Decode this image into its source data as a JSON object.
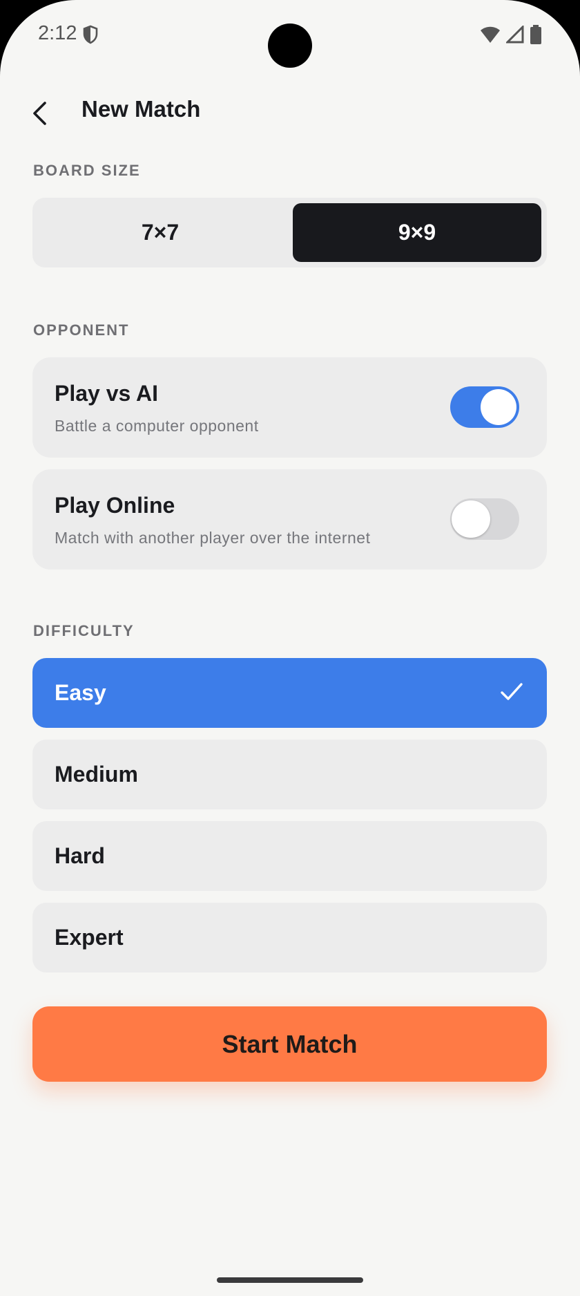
{
  "status_bar": {
    "time": "2:12",
    "icons": [
      "shield-icon",
      "wifi-icon",
      "cellular-icon",
      "battery-icon"
    ]
  },
  "app_bar": {
    "back_icon": "back-arrow-icon",
    "title": "New Match"
  },
  "board_size": {
    "label": "BOARD SIZE",
    "options": [
      "7×7",
      "9×9"
    ],
    "selected": "9×9"
  },
  "opponent": {
    "label": "OPPONENT",
    "options": [
      {
        "title": "Play vs AI",
        "subtitle": "Battle a computer opponent",
        "enabled": true
      },
      {
        "title": "Play Online",
        "subtitle": "Match with another player over the internet",
        "enabled": false
      }
    ]
  },
  "difficulty": {
    "label": "DIFFICULTY",
    "options": [
      "Easy",
      "Medium",
      "Hard",
      "Expert"
    ],
    "selected": "Easy",
    "selected_icon": "checkmark-icon"
  },
  "start_button": {
    "label": "Start Match"
  },
  "colors": {
    "background": "#f6f6f4",
    "accent_blue": "#3d7de9",
    "start_orange": "#ff7a45",
    "segment_selected": "#18191d",
    "card": "#ececec"
  }
}
